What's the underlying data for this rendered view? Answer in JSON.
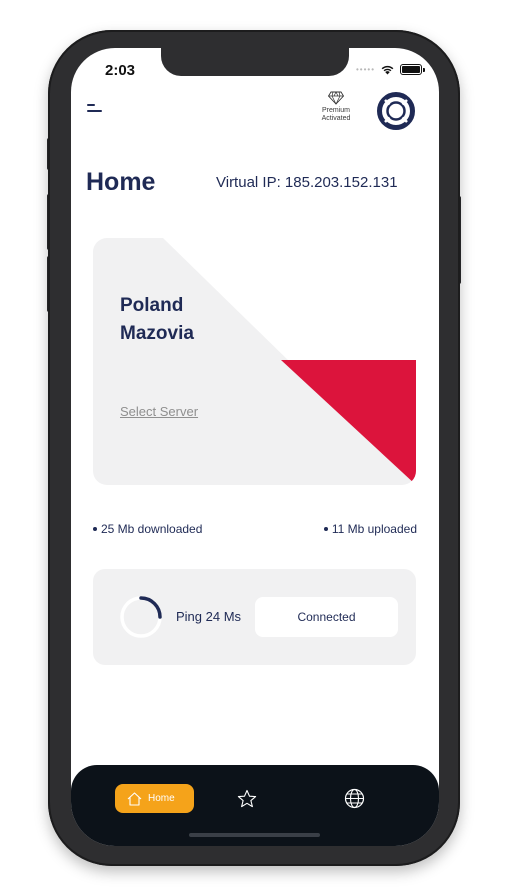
{
  "status_bar": {
    "time": "2:03",
    "signal_icon": "signal-dots-icon",
    "wifi_icon": "wifi-icon",
    "battery_icon": "battery-icon"
  },
  "header": {
    "menu_icon": "menu-icon",
    "premium_line1": "Premium",
    "premium_line2": "Activated",
    "premium_icon": "diamond-icon",
    "support_icon": "lifebuoy-icon"
  },
  "main": {
    "title": "Home",
    "virtual_ip": "Virtual IP: 185.203.152.131"
  },
  "server_card": {
    "country": "Poland",
    "region": "Mazovia",
    "select_label": "Select Server",
    "flag_color": "#dc143c"
  },
  "stats": {
    "downloaded": "25 Mb downloaded",
    "uploaded": "11 Mb uploaded"
  },
  "connection": {
    "ping": "Ping 24 Ms",
    "status": "Connected"
  },
  "bottom_nav": {
    "home_label": "Home",
    "home_icon": "home-icon",
    "favorites_icon": "star-icon",
    "globe_icon": "globe-icon",
    "active_color": "#f5a31a"
  },
  "colors": {
    "navy": "#1f2a55",
    "card_bg": "#f1f1f2",
    "nav_bg": "#0c1219"
  }
}
